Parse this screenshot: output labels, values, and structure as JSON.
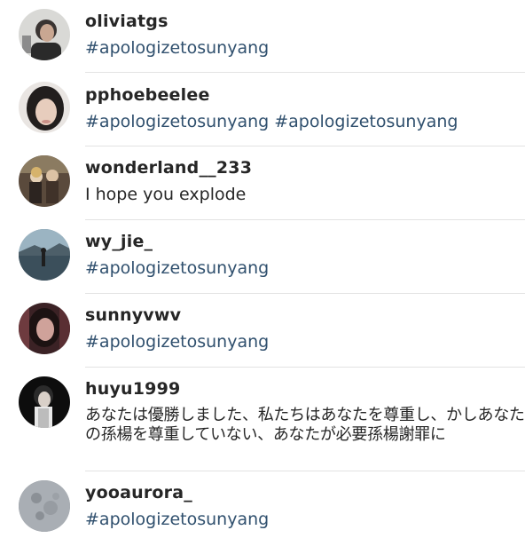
{
  "comments": [
    {
      "username": "oliviatgs",
      "text": "#apologizetosunyang",
      "avatar_icon": "user-photo-icon"
    },
    {
      "username": "pphoebeelee",
      "text": "#apologizetosunyang #apologizetosunyang",
      "avatar_icon": "user-photo-icon"
    },
    {
      "username": "wonderland__233",
      "text": "I hope you explode",
      "avatar_icon": "user-photo-icon"
    },
    {
      "username": "wy_jie_",
      "text": "#apologizetosunyang",
      "avatar_icon": "landscape-photo-icon"
    },
    {
      "username": "sunnyvwv",
      "text": "#apologizetosunyang",
      "avatar_icon": "user-photo-icon"
    },
    {
      "username": "huyu1999",
      "text": "あなたは優勝しました、私たちはあなたを尊重し、かしあなたの孫楊を尊重していない、あなたが必要孫楊謝罪に",
      "avatar_icon": "user-photo-icon"
    },
    {
      "username": "yooaurora_",
      "text": "#apologizetosunyang",
      "avatar_icon": "moon-photo-icon"
    }
  ],
  "colors": {
    "text": "#262626",
    "hashtag": "#30506e",
    "divider": "#e3e3e3"
  }
}
